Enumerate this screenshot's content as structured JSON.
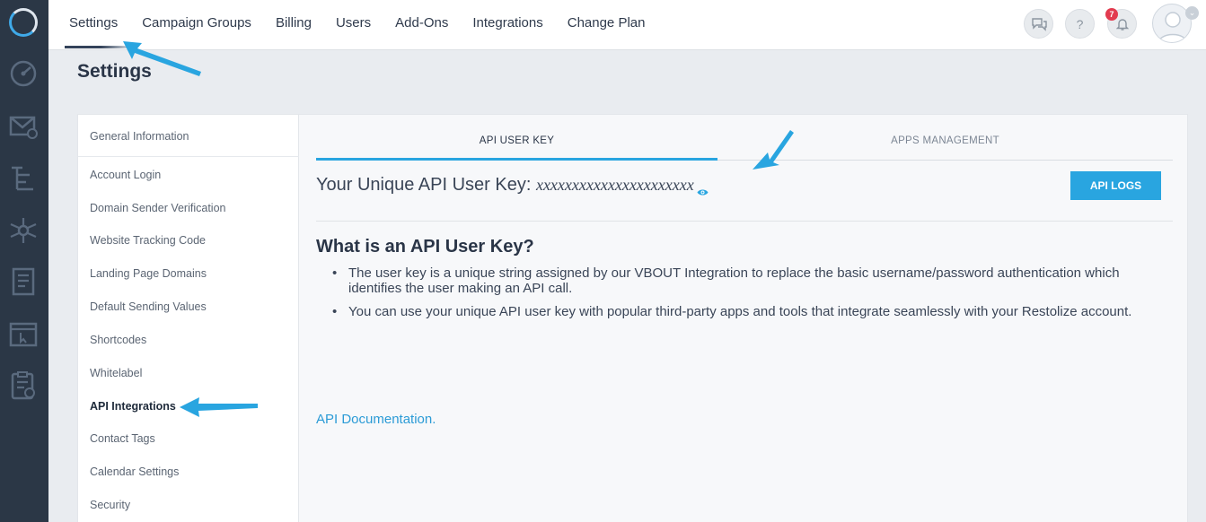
{
  "nav": {
    "items": [
      {
        "label": "Settings",
        "active": true
      },
      {
        "label": "Campaign Groups"
      },
      {
        "label": "Billing"
      },
      {
        "label": "Users"
      },
      {
        "label": "Add-Ons"
      },
      {
        "label": "Integrations"
      },
      {
        "label": "Change Plan"
      }
    ],
    "help_label": "?",
    "notification_count": "7"
  },
  "rail": {
    "icons": [
      "dashboard-icon",
      "email-icon",
      "automation-icon",
      "network-icon",
      "document-icon",
      "landing-page-icon",
      "clipboard-icon"
    ]
  },
  "page": {
    "title": "Settings"
  },
  "sidebar": {
    "header": "General Information",
    "items": [
      {
        "label": "Account Login"
      },
      {
        "label": "Domain Sender Verification"
      },
      {
        "label": "Website Tracking Code"
      },
      {
        "label": "Landing Page Domains"
      },
      {
        "label": "Default Sending Values"
      },
      {
        "label": "Shortcodes"
      },
      {
        "label": "Whitelabel"
      },
      {
        "label": "API Integrations",
        "active": true
      },
      {
        "label": "Contact Tags"
      },
      {
        "label": "Calendar Settings"
      },
      {
        "label": "Security"
      }
    ]
  },
  "tabs": [
    {
      "label": "API USER KEY",
      "active": true
    },
    {
      "label": "APPS MANAGEMENT"
    }
  ],
  "key": {
    "label": "Your Unique API User Key: ",
    "value": "xxxxxxxxxxxxxxxxxxxxxx",
    "button": "API LOGS"
  },
  "info": {
    "heading": "What is an API User Key?",
    "bullets": [
      "The user key is a unique string assigned by our VBOUT Integration to replace the basic username/password authentication which identifies the user making an API call.",
      "You can use your unique API user key with popular third-party apps and tools that integrate seamlessly with your Restolize account."
    ],
    "link": "API Documentation."
  },
  "colors": {
    "accent": "#29a5e0",
    "rail": "#2b3746",
    "badge": "#e23b4f"
  }
}
